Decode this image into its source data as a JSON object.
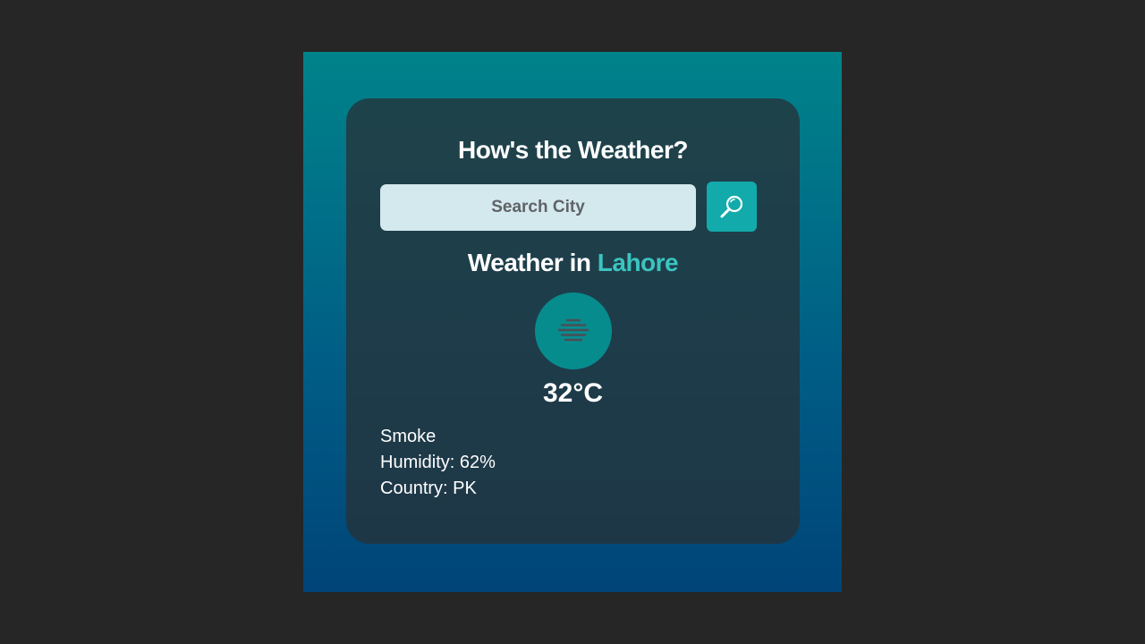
{
  "app": {
    "heading": "How's the Weather?"
  },
  "search": {
    "placeholder": "Search City",
    "value": "",
    "button_icon": "search-icon"
  },
  "weather": {
    "location_prefix": "Weather in",
    "city": "Lahore",
    "condition_icon": "smoke-haze-icon",
    "temperature": "32°C",
    "description": "Smoke",
    "humidity": "Humidity: 62%",
    "country": "Country: PK"
  },
  "colors": {
    "page_background": "#262626",
    "gradient_top": "#00838a",
    "gradient_bottom": "#004478",
    "card": "#263238",
    "accent": "#3bc4c0",
    "button": "#12aaaa",
    "input_background": "#d4e9ee"
  }
}
